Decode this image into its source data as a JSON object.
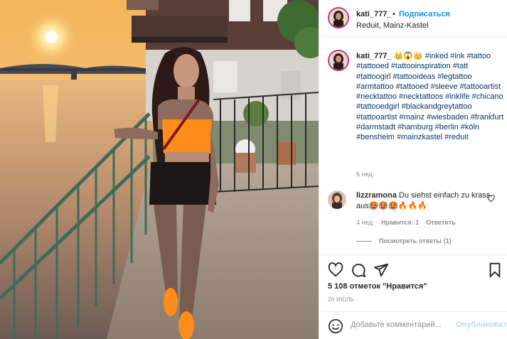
{
  "post": {
    "username": "kati_777_",
    "follow_label": "Подписаться",
    "separator": "•",
    "location": "Reduit, Mainz-Kastel"
  },
  "caption": {
    "username": "kati_777_",
    "crowns": "👑😱👑",
    "hashtags": "#inked #ink #tattoo #tattooed #tattooinspiration #tatt #tattoogirl #tattooideas #legtattoo #armtattoo #tattooed #sleeve #tattooartist #necktattoo #necktattoos #inklife #chicano #tattooedgirl #blackandgreytattoo #tattooartist #mainz #wiesbaden #frankfurt #darmstadt #hamburg #berlin #köln #bensheim #mainzkastel #reduit",
    "age": "6 нед."
  },
  "comment": {
    "username": "lizzramona",
    "text": "Du siehst einfach zu krass aus🥵🥵🥵🔥🔥🔥",
    "age": "4 нед.",
    "likes": "Нравится: 1",
    "reply": "Ответить",
    "view_replies": "Посмотреть ответы (1)"
  },
  "actions": {
    "likes_text": "5 108 отметок \"Нравится\"",
    "date": "20 ИЮЛЬ"
  },
  "add_comment": {
    "placeholder": "Добавьте комментарий...",
    "publish_label": "Опубликовать"
  },
  "icons": {
    "heart": "heart-icon",
    "comment": "comment-icon",
    "share": "share-icon",
    "bookmark": "bookmark-icon",
    "smile": "smile-icon"
  },
  "colors": {
    "link": "#0095f6",
    "hashtag": "#00376b",
    "muted": "#8e8e8e",
    "publish_disabled": "#b2dffc"
  }
}
